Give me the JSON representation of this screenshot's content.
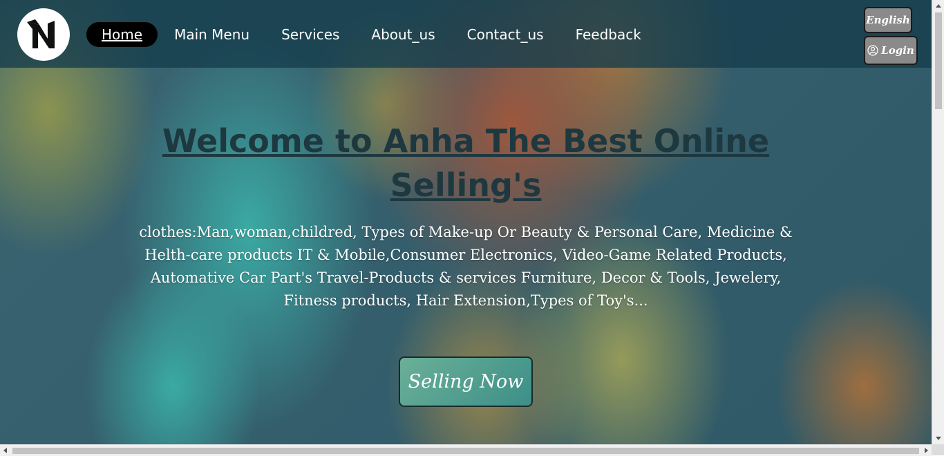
{
  "nav": {
    "items": [
      {
        "label": "Home",
        "active": true
      },
      {
        "label": "Main Menu"
      },
      {
        "label": "Services"
      },
      {
        "label": "About_us"
      },
      {
        "label": "Contact_us"
      },
      {
        "label": "Feedback"
      }
    ],
    "language_label": "English",
    "login_label": "Login"
  },
  "hero": {
    "title": "Welcome to Anha The Best Online Selling's",
    "description": "clothes:Man,woman,childred, Types of Make-up Or Beauty & Personal Care, Medicine & Helth-care products IT & Mobile,Consumer Electronics, Video-Game Related Products, Automative Car Part's Travel-Products & services Furniture, Decor & Tools, Jewelery, Fitness products, Hair Extension,Types of Toy's...",
    "cta_label": "Selling Now"
  },
  "icons": {
    "logo": "logo-icon",
    "user": "user-circle-icon"
  },
  "colors": {
    "nav_bg": "#143c4b",
    "active_nav_bg": "#000000",
    "title_color": "#1e3840",
    "top_button_bg": "#8a8a8a",
    "cta_bg": "#5aa294"
  }
}
